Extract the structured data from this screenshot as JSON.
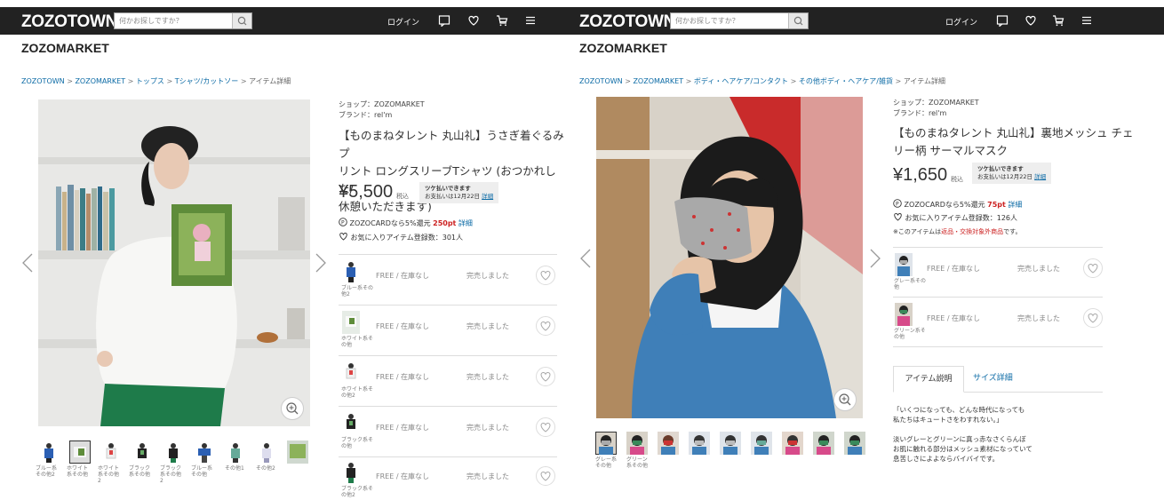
{
  "colors": {
    "header": "#222222",
    "link": "#0b6aa5",
    "accent_red": "#cc2222"
  },
  "left": {
    "logo": "ZOZOTOWN",
    "search_placeholder": "何かお探しですか？",
    "login": "ログイン",
    "market": "ZOZOMARKET",
    "breadcrumb": [
      "ZOZOTOWN",
      ">",
      "ZOZOMARKET",
      ">",
      "トップス",
      ">",
      "Tシャツ/カットソー",
      ">",
      "アイテム詳細"
    ],
    "shop": "ショップ：ZOZOMARKET",
    "brand": "ブランド：rel'm",
    "title_lines": [
      "【ものまねタレント 丸山礼】うさぎ着ぐるみプ",
      "リント ロングスリーブTシャツ (おつかれした/",
      "休憩いただきます)"
    ],
    "price": "¥5,500",
    "tax": "税込",
    "pay_later": {
      "line1": "ツケ払いできます",
      "line2": "お支払いは12月22日",
      "link": "詳細"
    },
    "points": {
      "prefix": "ZOZOCARDなら5%還元",
      "value": "250pt",
      "link": "詳細"
    },
    "favorites": "お気に入りアイテム登録数：301人",
    "thumbs": [
      {
        "label": "ブルー系\nその他2"
      },
      {
        "label": "ホワイト\n系その他"
      },
      {
        "label": "ホワイト\n系その他\n2"
      },
      {
        "label": "ブラック\n系その他"
      },
      {
        "label": "ブラック\n系その他\n2"
      },
      {
        "label": "ブルー系\nその他"
      },
      {
        "label": "その他1"
      },
      {
        "label": "その他2"
      },
      {
        "label": ""
      }
    ],
    "variants": [
      {
        "color": "ブルー系その\n他2",
        "size": "FREE / 在庫なし",
        "status": "完売しました"
      },
      {
        "color": "ホワイト系そ\nの他",
        "size": "FREE / 在庫なし",
        "status": "完売しました"
      },
      {
        "color": "ホワイト系そ\nの他2",
        "size": "FREE / 在庫なし",
        "status": "完売しました"
      },
      {
        "color": "ブラック系そ\nの他",
        "size": "FREE / 在庫なし",
        "status": "完売しました"
      },
      {
        "color": "ブラック系そ\nの他2",
        "size": "FREE / 在庫なし",
        "status": "完売しました"
      }
    ]
  },
  "right": {
    "logo": "ZOZOTOWN",
    "search_placeholder": "何かお探しですか？",
    "login": "ログイン",
    "market": "ZOZOMARKET",
    "breadcrumb": [
      "ZOZOTOWN",
      ">",
      "ZOZOMARKET",
      ">",
      "ボディ・ヘアケア/コンタクト",
      ">",
      "その他ボディ・ヘアケア/雑貨",
      ">",
      "アイテム詳細"
    ],
    "shop": "ショップ：ZOZOMARKET",
    "brand": "ブランド：rel'm",
    "title_lines": [
      "【ものまねタレント 丸山礼】裏地メッシュ チェ",
      "リー柄 サーマルマスク"
    ],
    "price": "¥1,650",
    "tax": "税込",
    "pay_later": {
      "line1": "ツケ払いできます",
      "line2": "お支払いは12月22日",
      "link": "詳細"
    },
    "points": {
      "prefix": "ZOZOCARDなら5%還元",
      "value": "75pt",
      "link": "詳細"
    },
    "favorites": "お気に入りアイテム登録数：126人",
    "note": {
      "prefix": "※このアイテムは",
      "red": "返品・交換対象外商品",
      "suffix": "です。"
    },
    "thumbs": [
      {
        "label": "グレー系\nその他"
      },
      {
        "label": "グリーン\n系その他"
      },
      {
        "label": ""
      },
      {
        "label": ""
      },
      {
        "label": ""
      },
      {
        "label": ""
      },
      {
        "label": ""
      },
      {
        "label": ""
      },
      {
        "label": ""
      }
    ],
    "variants": [
      {
        "color": "グレー系その\n他",
        "size": "FREE / 在庫なし",
        "status": "完売しました"
      },
      {
        "color": "グリーン系そ\nの他",
        "size": "FREE / 在庫なし",
        "status": "完売しました"
      }
    ],
    "tabs": {
      "description": "アイテム説明",
      "size": "サイズ詳細"
    },
    "description_lines": [
      "「いくつになっても、どんな時代になっても",
      "私たちはキュートさをわすれない。」",
      "",
      "淡いグレーとグリーンに真っ赤なさくらんぼ",
      "お肌に触れる部分はメッシュ素材になっていて",
      "息苦しさによよならバイバイです。"
    ]
  }
}
